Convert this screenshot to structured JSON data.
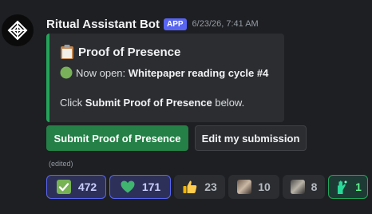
{
  "message": {
    "author": "Ritual Assistant Bot",
    "app_tag": "APP",
    "timestamp": "6/23/26, 7:41 AM",
    "edited": "(edited)"
  },
  "embed": {
    "title": "Proof of Presence",
    "status_prefix": "Now open:",
    "status_value": "Whitepaper reading cycle #4",
    "instruction_pre": "Click",
    "instruction_bold": "Submit Proof of Presence",
    "instruction_post": "below.",
    "accent_color": "#23a559"
  },
  "buttons": {
    "submit_label": "Submit Proof of Presence",
    "edit_label": "Edit my submission"
  },
  "reactions": [
    {
      "emoji": "check-mark-button",
      "count": "472",
      "reacted": true
    },
    {
      "emoji": "green-heart",
      "count": "171",
      "reacted": true
    },
    {
      "emoji": "thumbs-up",
      "count": "23",
      "reacted": false
    },
    {
      "emoji": "custom-portrait-1",
      "count": "10",
      "reacted": false
    },
    {
      "emoji": "custom-portrait-2",
      "count": "8",
      "reacted": false
    },
    {
      "emoji": "custom-glowing-hand",
      "count": "1",
      "reacted": false
    }
  ]
}
